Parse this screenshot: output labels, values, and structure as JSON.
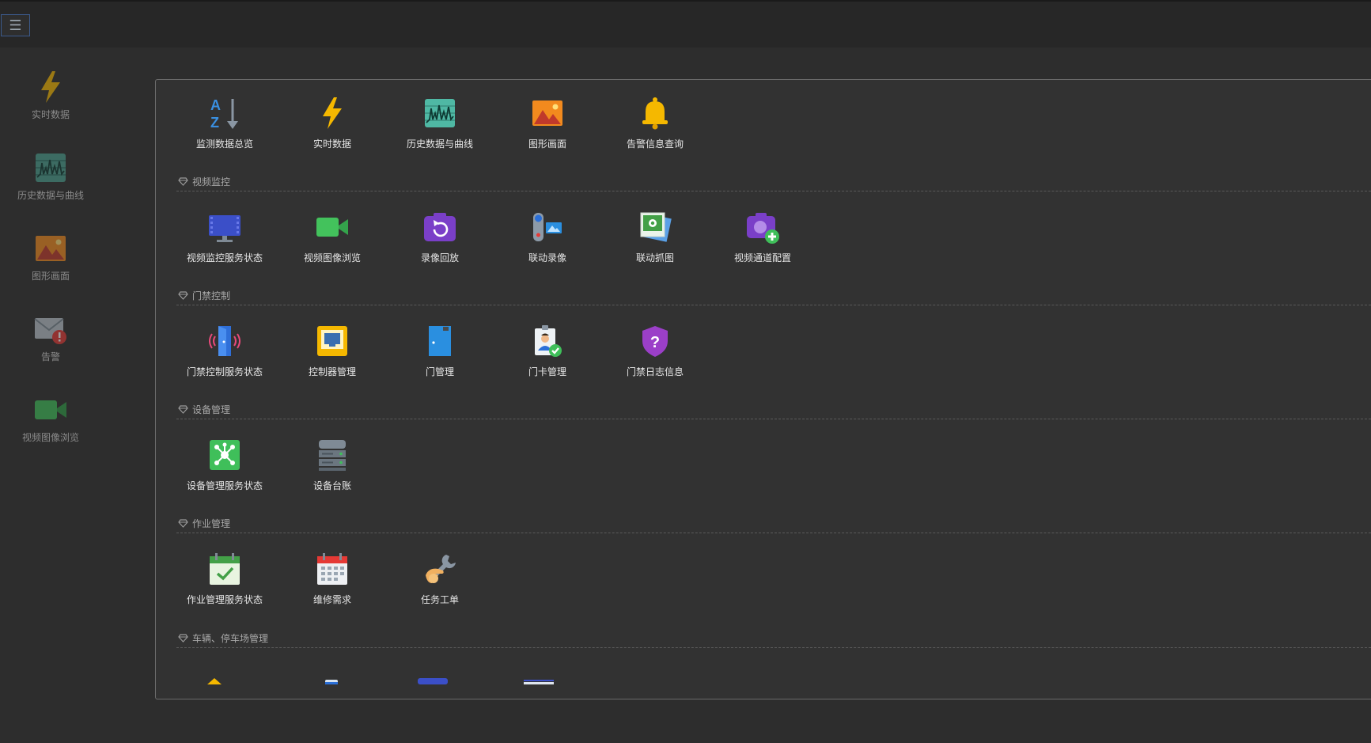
{
  "topbar": {
    "menu_glyph": "☰"
  },
  "sidebar": {
    "items": [
      {
        "label": "实时数据",
        "icon": "lightning-icon"
      },
      {
        "label": "历史数据与曲线",
        "icon": "history-chart-icon"
      },
      {
        "label": "图形画面",
        "icon": "picture-icon"
      },
      {
        "label": "告警",
        "icon": "alarm-mail-icon"
      },
      {
        "label": "视频图像浏览",
        "icon": "video-camera-icon"
      }
    ]
  },
  "panel": {
    "top_row": [
      {
        "label": "监测数据总览",
        "icon": "az-sort-icon"
      },
      {
        "label": "实时数据",
        "icon": "lightning-icon"
      },
      {
        "label": "历史数据与曲线",
        "icon": "history-chart-icon"
      },
      {
        "label": "图形画面",
        "icon": "picture-icon"
      },
      {
        "label": "告警信息查询",
        "icon": "bell-icon"
      }
    ],
    "sections": [
      {
        "title": "视频监控",
        "items": [
          {
            "label": "视频监控服务状态",
            "icon": "monitor-icon"
          },
          {
            "label": "视频图像浏览",
            "icon": "video-camera-icon"
          },
          {
            "label": "录像回放",
            "icon": "replay-camera-icon"
          },
          {
            "label": "联动录像",
            "icon": "camcorder-icon"
          },
          {
            "label": "联动抓图",
            "icon": "photos-icon"
          },
          {
            "label": "视频通道配置",
            "icon": "camera-add-icon"
          }
        ]
      },
      {
        "title": "门禁控制",
        "items": [
          {
            "label": "门禁控制服务状态",
            "icon": "door-signal-icon"
          },
          {
            "label": "控制器管理",
            "icon": "controller-icon"
          },
          {
            "label": "门管理",
            "icon": "door-icon"
          },
          {
            "label": "门卡管理",
            "icon": "id-card-icon"
          },
          {
            "label": "门禁日志信息",
            "icon": "shield-question-icon"
          }
        ]
      },
      {
        "title": "设备管理",
        "items": [
          {
            "label": "设备管理服务状态",
            "icon": "network-hub-icon"
          },
          {
            "label": "设备台账",
            "icon": "server-icon"
          }
        ]
      },
      {
        "title": "作业管理",
        "items": [
          {
            "label": "作业管理服务状态",
            "icon": "calendar-check-icon"
          },
          {
            "label": "维修需求",
            "icon": "calendar-icon"
          },
          {
            "label": "任务工单",
            "icon": "wrench-hand-icon"
          }
        ]
      },
      {
        "title": "车辆、停车场管理",
        "items": []
      }
    ]
  }
}
